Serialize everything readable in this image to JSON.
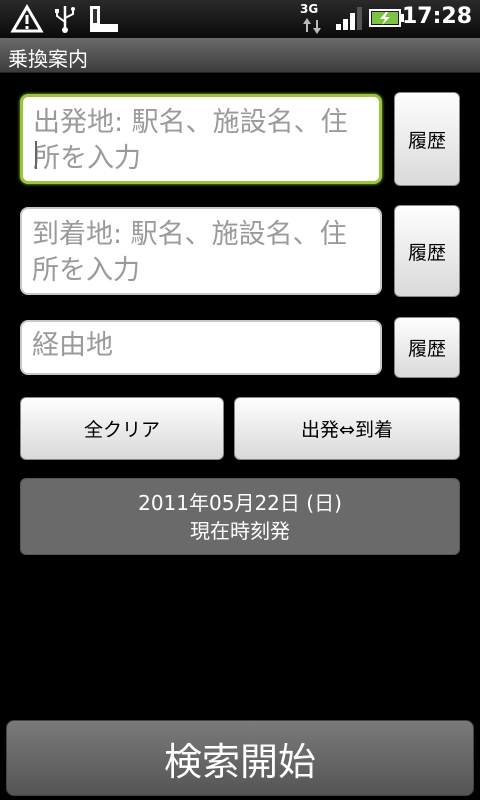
{
  "status": {
    "time": "17:28",
    "network_label": "3G"
  },
  "app": {
    "title": "乗換案内"
  },
  "form": {
    "departure_placeholder": "出発地: 駅名、施設名、住所を入力",
    "arrival_placeholder": "到着地: 駅名、施設名、住所を入力",
    "via_placeholder": "経由地",
    "history_label": "履歴"
  },
  "actions": {
    "clear_all": "全クリア",
    "swap": "出発⇔到着"
  },
  "datetime": {
    "date": "2011年05月22日 (日)",
    "mode": "現在時刻発"
  },
  "search": {
    "label": "検索開始"
  }
}
